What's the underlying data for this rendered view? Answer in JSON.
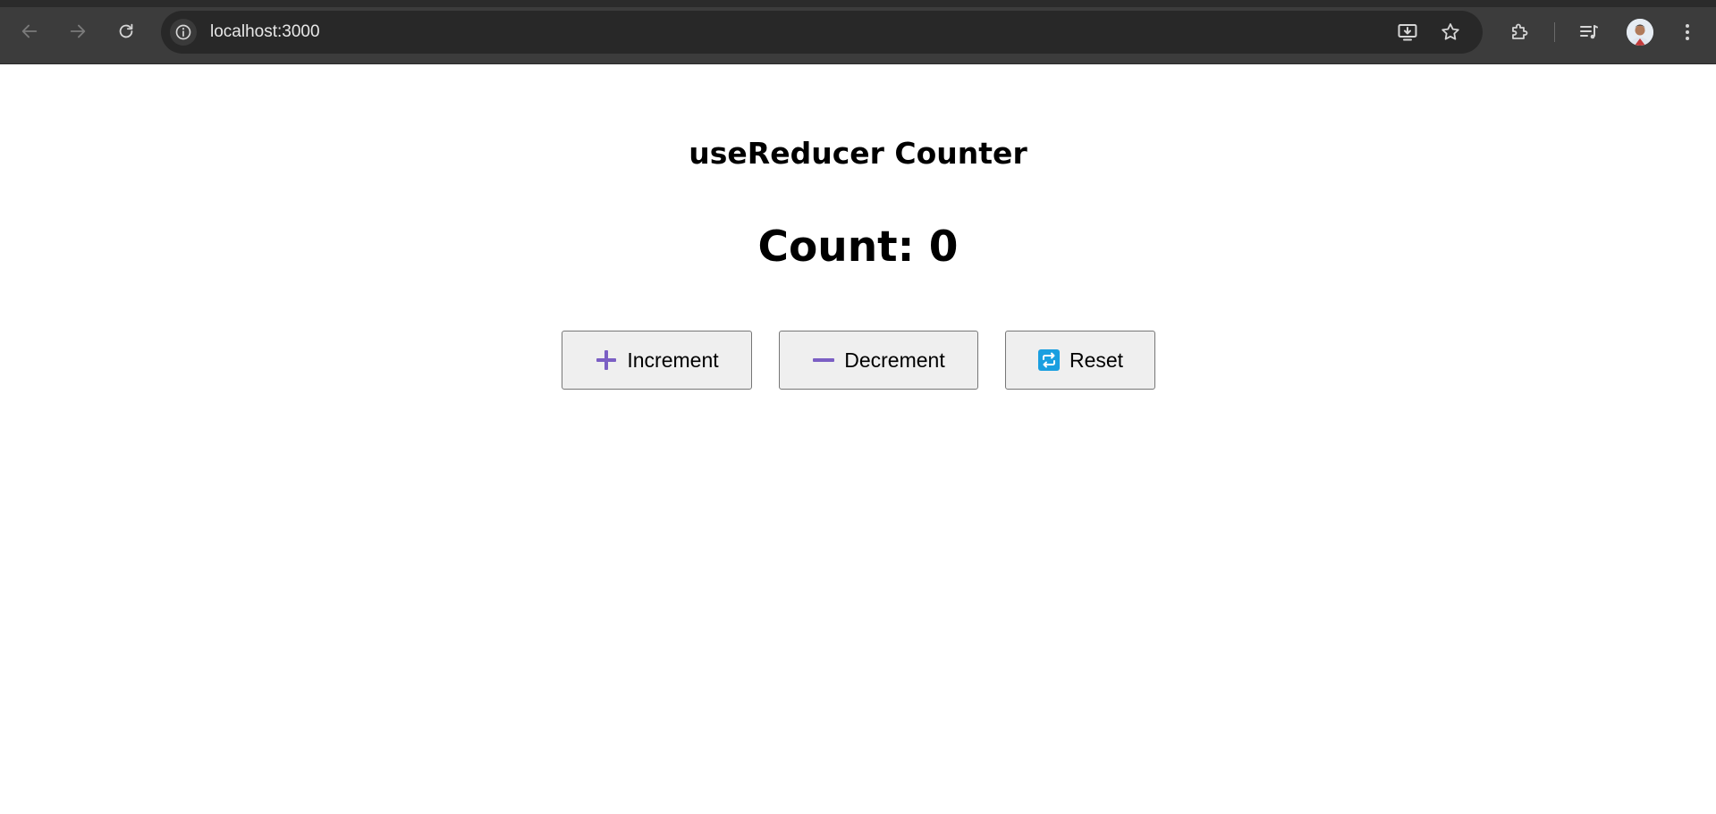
{
  "browser": {
    "url": "localhost:3000",
    "icons": {
      "back": "arrow-left-icon",
      "forward": "arrow-right-icon",
      "reload": "reload-icon",
      "site_info": "info-icon",
      "install": "install-app-icon",
      "bookmark": "star-icon",
      "extensions": "puzzle-icon",
      "media": "media-controls-icon",
      "profile": "avatar",
      "menu": "kebab-menu-icon"
    }
  },
  "app": {
    "heading": "useReducer Counter",
    "count_label": "Count: 0",
    "buttons": {
      "increment": {
        "label": "Increment",
        "icon": "plus-icon",
        "icon_color": "#7b5fc4"
      },
      "decrement": {
        "label": "Decrement",
        "icon": "minus-icon",
        "icon_color": "#7b5fc4"
      },
      "reset": {
        "label": "Reset",
        "icon": "repeat-icon",
        "icon_color": "#1a9fe0"
      }
    }
  }
}
